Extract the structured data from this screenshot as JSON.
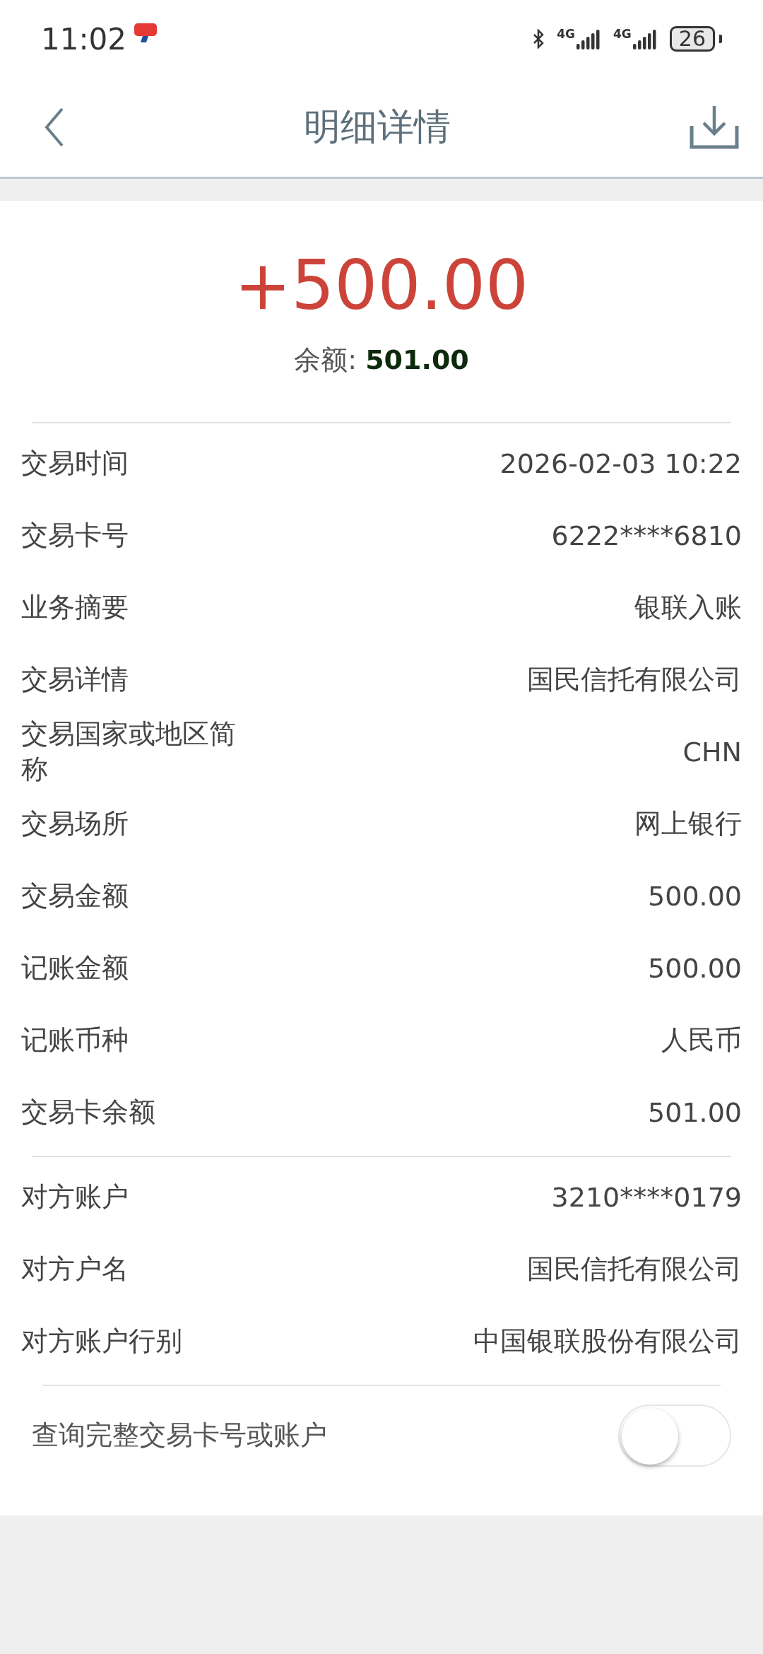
{
  "status_bar": {
    "time": "11:02",
    "signals": [
      {
        "label": "4G"
      },
      {
        "label": "4G"
      }
    ],
    "battery": "26"
  },
  "header": {
    "title": "明细详情"
  },
  "summary": {
    "amount": "+500.00",
    "balance_label": "余额:",
    "balance_value": "501.00"
  },
  "sections": [
    {
      "rows": [
        {
          "label": "交易时间",
          "value": "2026-02-03 10:22"
        },
        {
          "label": "交易卡号",
          "value": "6222****6810"
        },
        {
          "label": "业务摘要",
          "value": "银联入账"
        },
        {
          "label": "交易详情",
          "value": "国民信托有限公司"
        },
        {
          "label": "交易国家或地区简称",
          "value": "CHN"
        },
        {
          "label": "交易场所",
          "value": "网上银行"
        },
        {
          "label": "交易金额",
          "value": "500.00"
        },
        {
          "label": "记账金额",
          "value": "500.00"
        },
        {
          "label": "记账币种",
          "value": "人民币"
        },
        {
          "label": "交易卡余额",
          "value": "501.00"
        }
      ]
    },
    {
      "rows": [
        {
          "label": "对方账户",
          "value": "3210****0179"
        },
        {
          "label": "对方户名",
          "value": "国民信托有限公司"
        },
        {
          "label": "对方账户行别",
          "value": "中国银联股份有限公司"
        }
      ]
    }
  ],
  "toggle": {
    "label": "查询完整交易卡号或账户",
    "on": false
  }
}
